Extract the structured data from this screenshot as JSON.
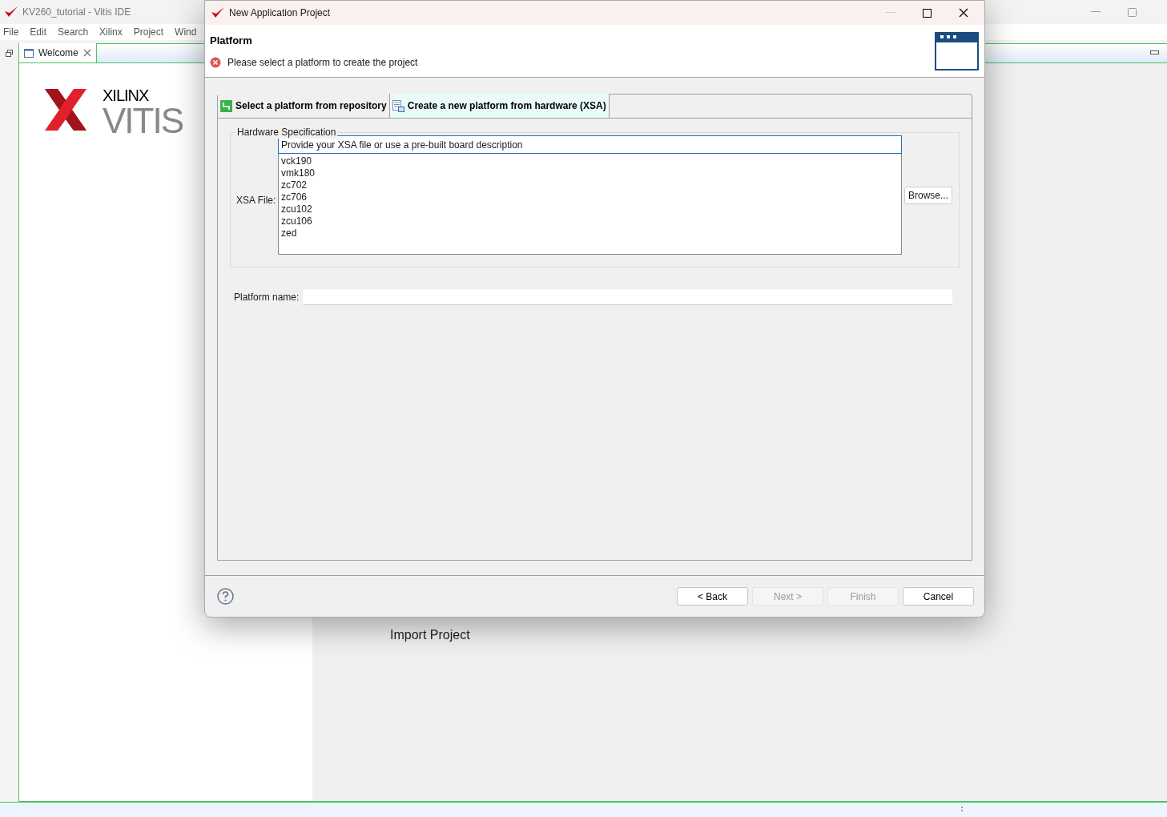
{
  "ide": {
    "title": "KV260_tutorial - Vitis IDE",
    "menu": [
      "File",
      "Edit",
      "Search",
      "Xilinx",
      "Project",
      "Wind"
    ],
    "editor_tab": {
      "label": "Welcome"
    },
    "logo": {
      "brand": "XILINX",
      "product": "VITIS"
    },
    "welcome_links": [
      "Import Project"
    ]
  },
  "dialog": {
    "title": "New Application Project",
    "header": {
      "title": "Platform",
      "message": "Please select a platform to create the project"
    },
    "tabs": [
      {
        "label": "Select a platform from repository",
        "selected": false
      },
      {
        "label": "Create a new platform from hardware (XSA)",
        "selected": true
      }
    ],
    "group": {
      "title": "Hardware Specification",
      "xsa_label": "XSA File:",
      "xsa_field": {
        "value": "Provide your XSA file or use a pre-built board description"
      },
      "boards": [
        "vck190",
        "vmk180",
        "zc702",
        "zc706",
        "zcu102",
        "zcu106",
        "zed"
      ],
      "browse": "Browse..."
    },
    "platform_name": {
      "label": "Platform name:"
    },
    "buttons": [
      {
        "label": "< Back",
        "disabled": false
      },
      {
        "label": "Next >",
        "disabled": true
      },
      {
        "label": "Finish",
        "disabled": true
      },
      {
        "label": "Cancel",
        "disabled": false
      }
    ]
  }
}
